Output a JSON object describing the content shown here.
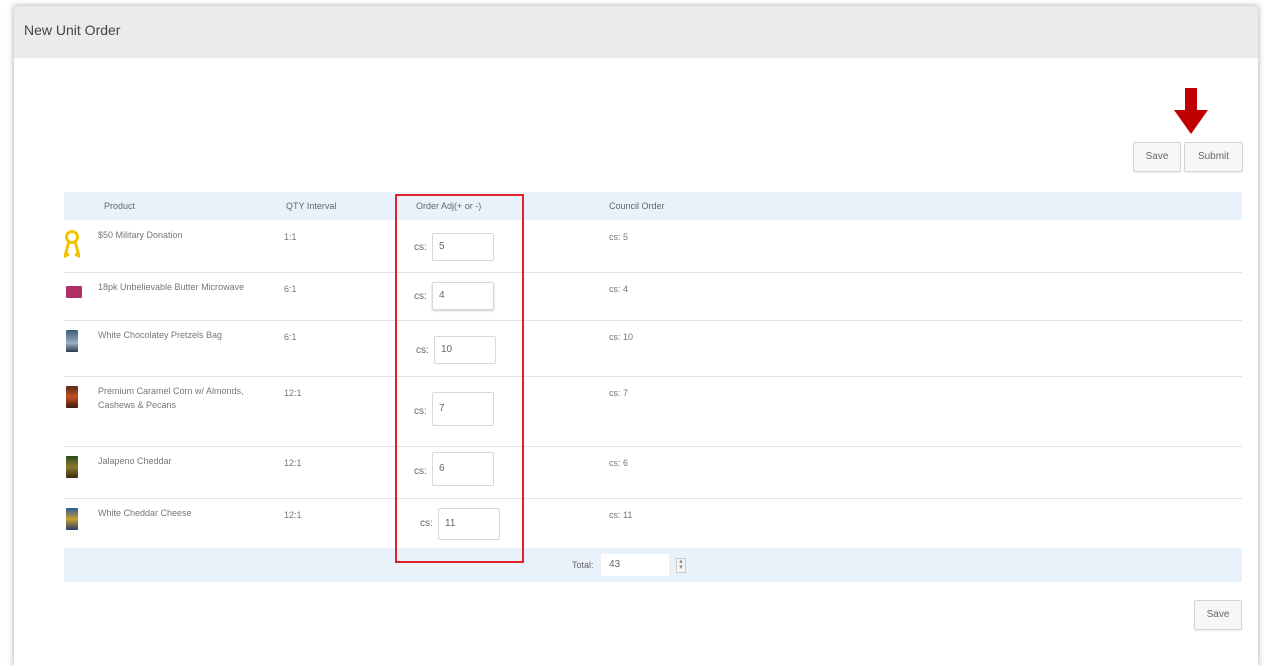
{
  "window": {
    "title": "New Unit Order"
  },
  "toolbar": {
    "save_label": "Save",
    "submit_label": "Submit"
  },
  "table": {
    "headers": {
      "product": "Product",
      "qty_interval": "QTY Interval",
      "order_adj": "Order Adj(+ or -)",
      "council_order": "Council Order"
    },
    "cs_label": "cs:",
    "rows": [
      {
        "product": "$50 Military Donation",
        "qty_interval": "1:1",
        "order_adj": "5",
        "council_order": "cs: 5",
        "thumb_icon": "ribbon-icon"
      },
      {
        "product": "18pk Unbelievable Butter Microwave",
        "qty_interval": "6:1",
        "order_adj": "4",
        "council_order": "cs: 4",
        "thumb_icon": "popcorn-pack-icon"
      },
      {
        "product": "White Chocolatey Pretzels Bag",
        "qty_interval": "6:1",
        "order_adj": "10",
        "council_order": "cs: 10",
        "thumb_icon": "pretzel-bag-icon"
      },
      {
        "product": "Premium Caramel Corn w/ Almonds, Cashews & Pecans",
        "qty_interval": "12:1",
        "order_adj": "7",
        "council_order": "cs: 7",
        "thumb_icon": "caramel-corn-icon"
      },
      {
        "product": "Jalapeno Cheddar",
        "qty_interval": "12:1",
        "order_adj": "6",
        "council_order": "cs: 6",
        "thumb_icon": "jalapeno-bag-icon"
      },
      {
        "product": "White Cheddar Cheese",
        "qty_interval": "12:1",
        "order_adj": "11",
        "council_order": "cs: 11",
        "thumb_icon": "cheddar-bag-icon"
      }
    ],
    "total_label": "Total:",
    "total_value": "43"
  },
  "footer": {
    "save_label": "Save"
  },
  "colors": {
    "highlight": "#e0202a",
    "arrow": "#c00000",
    "header_bg": "#e9f2fb"
  }
}
